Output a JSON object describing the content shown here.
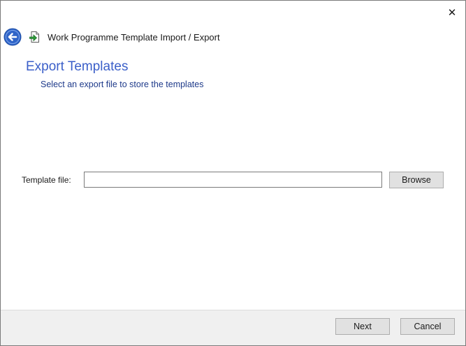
{
  "window": {
    "title": "Work Programme Template Import / Export",
    "close_glyph": "✕",
    "close_icon": "close-icon",
    "back_icon": "back-arrow-icon",
    "app_icon": "template-import-export-icon"
  },
  "page": {
    "heading": "Export Templates",
    "subheading": "Select an export file to store the templates"
  },
  "form": {
    "template_file_label": "Template file:",
    "template_file_value": "",
    "browse_label": "Browse"
  },
  "footer": {
    "next_label": "Next",
    "cancel_label": "Cancel"
  },
  "colors": {
    "heading": "#3b5fc9",
    "subheading": "#1e3a8a",
    "back_button": "#2f64c8",
    "footer_bg": "#f0f0f0",
    "button_bg": "#e1e1e1"
  }
}
